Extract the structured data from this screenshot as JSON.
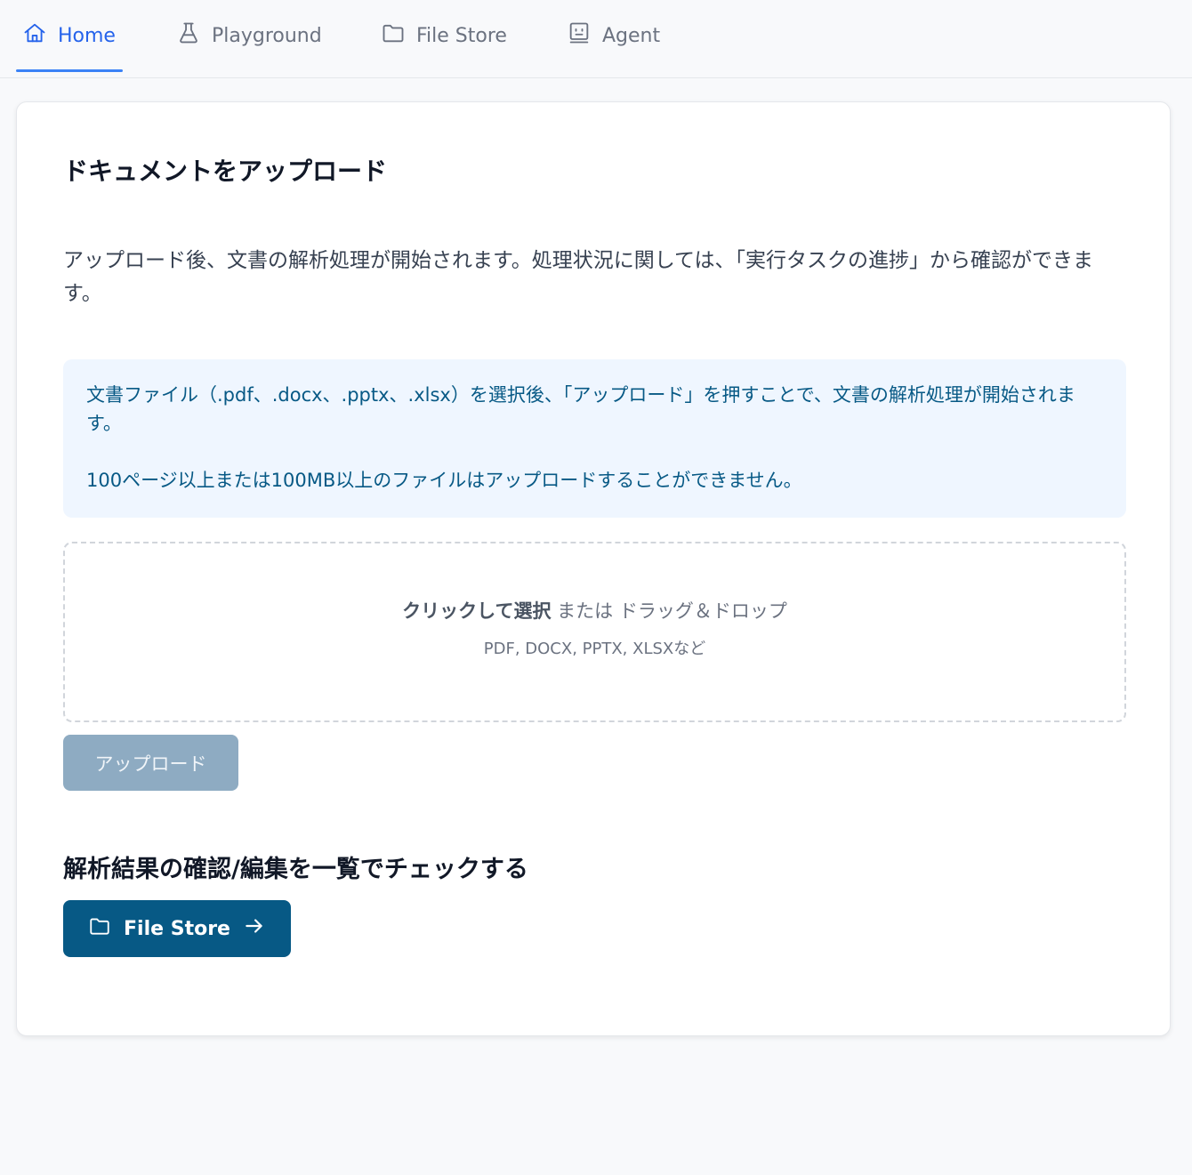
{
  "nav": {
    "tabs": [
      {
        "label": "Home",
        "icon": "home-icon",
        "active": true
      },
      {
        "label": "Playground",
        "icon": "flask-icon",
        "active": false
      },
      {
        "label": "File Store",
        "icon": "folder-icon",
        "active": false
      },
      {
        "label": "Agent",
        "icon": "robot-icon",
        "active": false
      }
    ]
  },
  "upload": {
    "title": "ドキュメントをアップロード",
    "description": "アップロード後、文書の解析処理が開始されます。処理状況に関しては、「実行タスクの進捗」から確認ができます。",
    "info": {
      "line1": "文書ファイル（.pdf、.docx、.pptx、.xlsx）を選択後、「アップロード」を押すことで、文書の解析処理が開始されます。",
      "line2": "100ページ以上または100MB以上のファイルはアップロードすることができません。"
    },
    "dropzone": {
      "click_text": "クリックして選択",
      "or_text": " または ドラッグ＆ドロップ",
      "formats": "PDF, DOCX, PPTX, XLSXなど"
    },
    "button_label": "アップロード",
    "button_disabled": true
  },
  "review": {
    "title": "解析結果の確認/編集を一覧でチェックする",
    "button_label": "File Store",
    "button_icon": "folder-icon",
    "button_trailing_icon": "arrow-right-icon"
  },
  "colors": {
    "accent": "#2563eb",
    "primary_button": "#075985",
    "disabled_button": "#8eabc2",
    "info_bg": "#eff6ff",
    "info_text": "#075985"
  }
}
